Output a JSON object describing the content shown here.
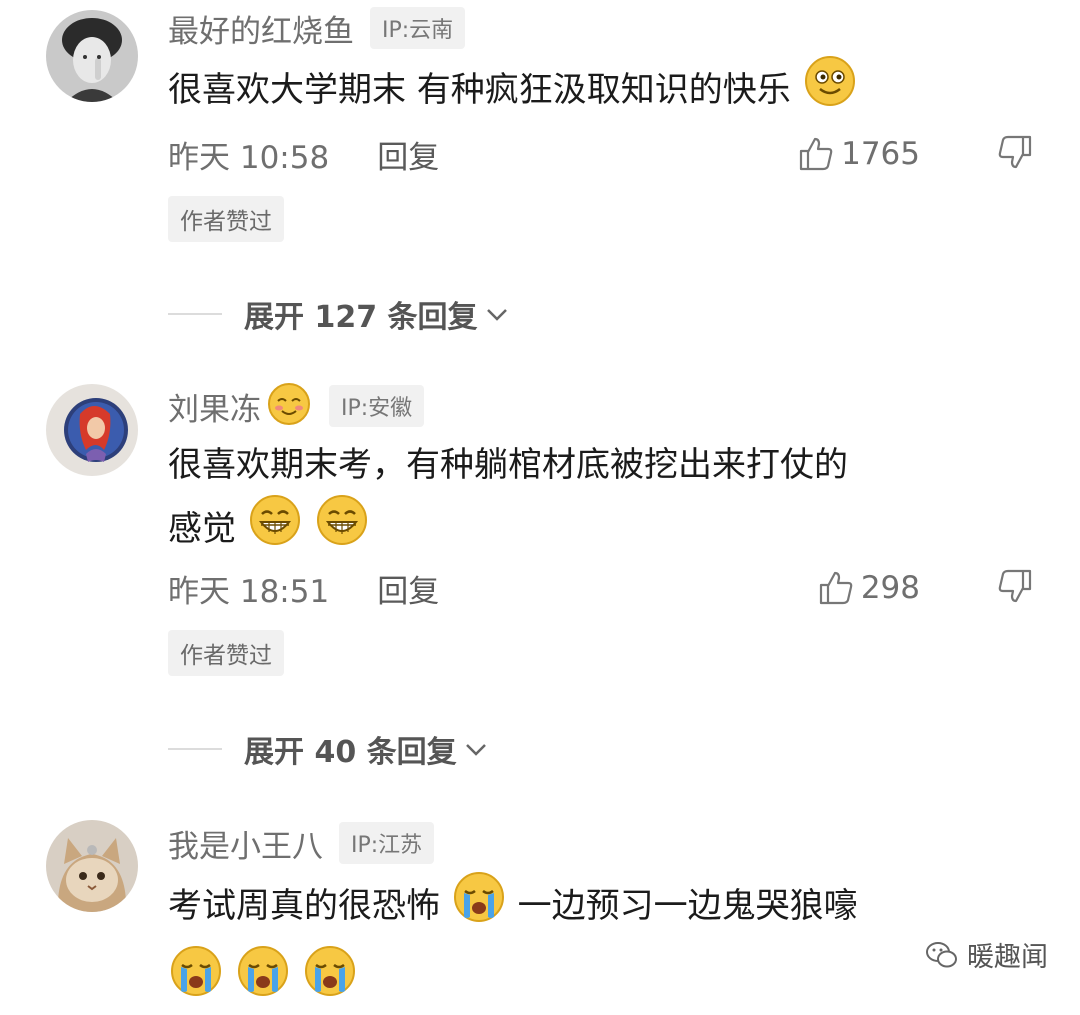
{
  "comments": [
    {
      "username": "最好的红烧鱼",
      "ip": "IP:云南",
      "text": "很喜欢大学期末 有种疯狂汲取知识的快乐",
      "time": "昨天 10:58",
      "reply_label": "回复",
      "likes": "1765",
      "author_badge": "作者赞过",
      "expand_label": "展开 127 条回复"
    },
    {
      "username": "刘果冻",
      "ip": "IP:安徽",
      "text_line1": "很喜欢期末考，有种躺棺材底被挖出来打仗的",
      "text_line2": "感觉",
      "time": "昨天 18:51",
      "reply_label": "回复",
      "likes": "298",
      "author_badge": "作者赞过",
      "expand_label": "展开 40 条回复"
    },
    {
      "username": "我是小王八",
      "ip": "IP:江苏",
      "text_part1": "考试周真的很恐怖",
      "text_part2": "一边预习一边鬼哭狼嚎"
    }
  ],
  "watermark": {
    "text": "暖趣闻"
  },
  "icons": [
    "thumb-up-icon",
    "thumb-down-icon",
    "chevron-down-icon",
    "smile-emoji-icon",
    "shy-smile-emoji-icon",
    "grin-emoji-icon",
    "crying-emoji-icon",
    "wechat-icon"
  ]
}
